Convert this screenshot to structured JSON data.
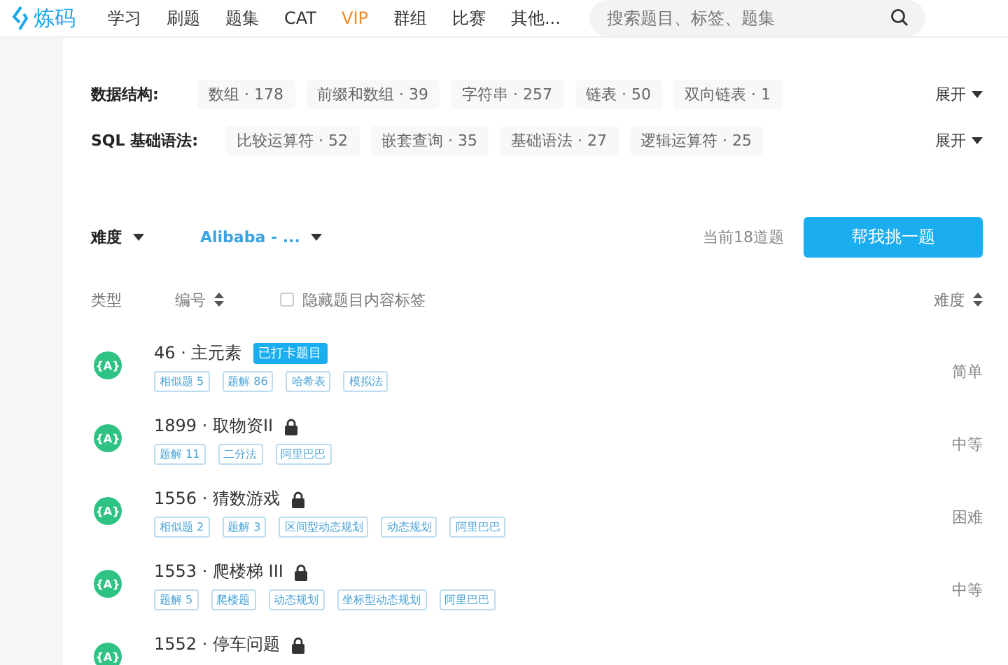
{
  "nav": {
    "brand": "炼码",
    "items": [
      {
        "label": "学习",
        "highlight": false
      },
      {
        "label": "刷题",
        "highlight": false
      },
      {
        "label": "题集",
        "highlight": false
      },
      {
        "label": "CAT",
        "highlight": false
      },
      {
        "label": "VIP",
        "highlight": true
      },
      {
        "label": "群组",
        "highlight": false
      },
      {
        "label": "比赛",
        "highlight": false
      },
      {
        "label": "其他...",
        "highlight": false
      }
    ],
    "search": {
      "placeholder": "搜索题目、标签、题集"
    }
  },
  "filters": [
    {
      "label": "数据结构:",
      "tags": [
        "数组 · 178",
        "前缀和数组 · 39",
        "字符串 · 257",
        "链表 · 50",
        "双向链表 · 1"
      ],
      "expand": "展开"
    },
    {
      "label": "SQL 基础语法:",
      "tags": [
        "比较运算符 · 52",
        "嵌套查询 · 35",
        "基础语法 · 27",
        "逻辑运算符 · 25"
      ],
      "expand": "展开"
    }
  ],
  "toolbar": {
    "difficulty": "难度",
    "company": "Alibaba - ...",
    "count": "当前18道题",
    "pick_button": "帮我挑一题"
  },
  "columns": {
    "type": "类型",
    "number": "编号",
    "hide_tags": {
      "label": "隐藏题目内容标签",
      "checked": false
    },
    "difficulty": "难度"
  },
  "problems": [
    {
      "type": "{A}",
      "title": "46 · 主元素",
      "locked": false,
      "badge": "已打卡题目",
      "tags": [
        "相似题 5",
        "题解 86",
        "哈希表",
        "模拟法"
      ],
      "difficulty": "简单"
    },
    {
      "type": "{A}",
      "title": "1899 · 取物资II",
      "locked": true,
      "tags": [
        "题解 11",
        "二分法",
        "阿里巴巴"
      ],
      "difficulty": "中等"
    },
    {
      "type": "{A}",
      "title": "1556 · 猜数游戏",
      "locked": true,
      "tags": [
        "相似题 2",
        "题解 3",
        "区间型动态规划",
        "动态规划",
        "阿里巴巴"
      ],
      "difficulty": "困难"
    },
    {
      "type": "{A}",
      "title": "1553 · 爬楼梯 III",
      "locked": true,
      "tags": [
        "题解 5",
        "爬楼题",
        "动态规划",
        "坐标型动态规划",
        "阿里巴巴"
      ],
      "difficulty": "中等"
    },
    {
      "type": "{A}",
      "title": "1552 · 停车问题",
      "locked": true
    }
  ]
}
